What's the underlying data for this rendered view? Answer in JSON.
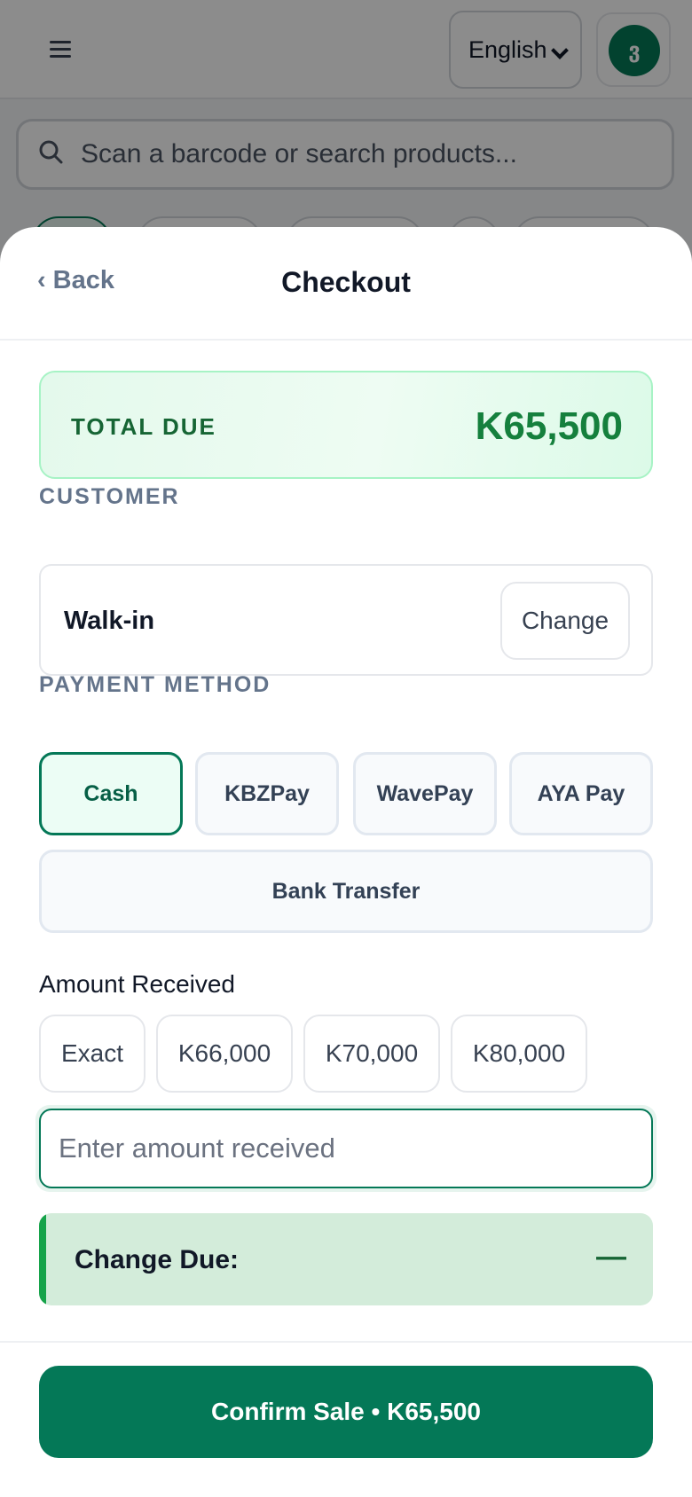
{
  "background": {
    "language": {
      "selected": "English"
    },
    "avatar_initial": "ვ",
    "search": {
      "placeholder": "Scan a barcode or search products..."
    }
  },
  "checkout": {
    "back_label": "Back",
    "title": "Checkout",
    "total": {
      "label": "TOTAL DUE",
      "amount": "K65,500"
    },
    "customer": {
      "section_label": "CUSTOMER",
      "name": "Walk-in",
      "change_label": "Change"
    },
    "payment": {
      "section_label": "PAYMENT METHOD",
      "methods": [
        "Cash",
        "KBZPay",
        "WavePay",
        "AYA Pay",
        "Bank Transfer"
      ],
      "selected": "Cash"
    },
    "amount": {
      "label": "Amount Received",
      "quick": [
        "Exact",
        "K66,000",
        "K70,000",
        "K80,000"
      ],
      "placeholder": "Enter amount received",
      "value": ""
    },
    "change_due": {
      "label": "Change Due:",
      "value": "—"
    },
    "confirm_label": "Confirm Sale • K65,500"
  },
  "colors": {
    "brand": "#047857",
    "total_bg": "#e4f9ec",
    "change_due_bg": "#d3ecda",
    "change_due_accent": "#16a34a"
  }
}
